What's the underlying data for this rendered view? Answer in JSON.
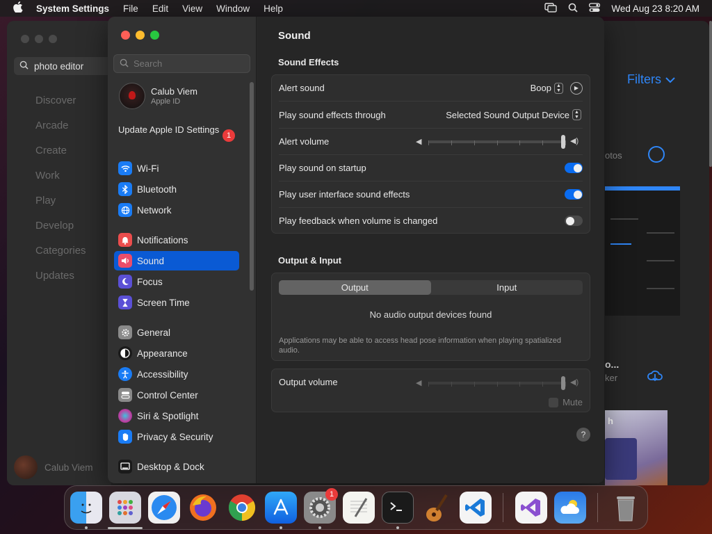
{
  "menubar": {
    "app_name": "System Settings",
    "menus": [
      "File",
      "Edit",
      "View",
      "Window",
      "Help"
    ],
    "datetime": "Wed Aug 23  8:20 AM"
  },
  "background_app": {
    "search_value": "photo editor",
    "nav": [
      "Discover",
      "Arcade",
      "Create",
      "Work",
      "Play",
      "Develop",
      "Categories",
      "Updates"
    ],
    "user_name": "Calub Viem",
    "filters_label": "Filters",
    "photos_fragment": "otos",
    "title_fragment": "o...",
    "subtitle_fragment": "ker",
    "thumb_fragment": "h"
  },
  "sidebar": {
    "search_placeholder": "Search",
    "user": {
      "name": "Calub Viem",
      "subtitle": "Apple ID"
    },
    "update": {
      "label": "Update Apple ID Settings",
      "badge": "1"
    },
    "items": [
      {
        "label": "Wi-Fi",
        "icon": "wifi-icon",
        "color": "#1a7cf5"
      },
      {
        "label": "Bluetooth",
        "icon": "bluetooth-icon",
        "color": "#1a7cf5"
      },
      {
        "label": "Network",
        "icon": "globe-icon",
        "color": "#1a7cf5"
      },
      {
        "label": "Notifications",
        "icon": "bell-icon",
        "color": "#eb4d4d"
      },
      {
        "label": "Sound",
        "icon": "speaker-icon",
        "color": "#eb4d6a"
      },
      {
        "label": "Focus",
        "icon": "moon-icon",
        "color": "#5b50d6"
      },
      {
        "label": "Screen Time",
        "icon": "hourglass-icon",
        "color": "#5b50d6"
      },
      {
        "label": "General",
        "icon": "gear-icon",
        "color": "#8a8a8a"
      },
      {
        "label": "Appearance",
        "icon": "appearance-icon",
        "color": "#1a1a1a"
      },
      {
        "label": "Accessibility",
        "icon": "accessibility-icon",
        "color": "#1a7cf5"
      },
      {
        "label": "Control Center",
        "icon": "control-center-icon",
        "color": "#8a8a8a"
      },
      {
        "label": "Siri & Spotlight",
        "icon": "siri-icon",
        "color": "#c040a0"
      },
      {
        "label": "Privacy & Security",
        "icon": "hand-icon",
        "color": "#1a7cf5"
      },
      {
        "label": "Desktop & Dock",
        "icon": "desktop-icon",
        "color": "#1a1a1a"
      }
    ],
    "selected": "Sound"
  },
  "main": {
    "title": "Sound",
    "sound_effects": {
      "heading": "Sound Effects",
      "alert_sound_label": "Alert sound",
      "alert_sound_value": "Boop",
      "play_through_label": "Play sound effects through",
      "play_through_value": "Selected Sound Output Device",
      "alert_volume_label": "Alert volume",
      "alert_volume_level": 1.0,
      "startup_label": "Play sound on startup",
      "startup_on": true,
      "ui_sounds_label": "Play user interface sound effects",
      "ui_sounds_on": true,
      "feedback_label": "Play feedback when volume is changed",
      "feedback_on": false
    },
    "output_input": {
      "heading": "Output & Input",
      "tabs": [
        "Output",
        "Input"
      ],
      "active_tab": "Output",
      "no_devices": "No audio output devices found",
      "note": "Applications may be able to access head pose information when playing spatialized audio."
    },
    "output_volume": {
      "label": "Output volume",
      "level": 1.0,
      "mute_label": "Mute"
    },
    "help": "?"
  },
  "dock": {
    "badge": "1",
    "apps": [
      "Finder",
      "Launchpad",
      "Safari",
      "Firefox",
      "Chrome",
      "App Store",
      "System Settings",
      "TextEdit",
      "Terminal",
      "GarageBand",
      "Visual Studio Code",
      "Visual Studio",
      "Weather",
      "Trash"
    ]
  }
}
